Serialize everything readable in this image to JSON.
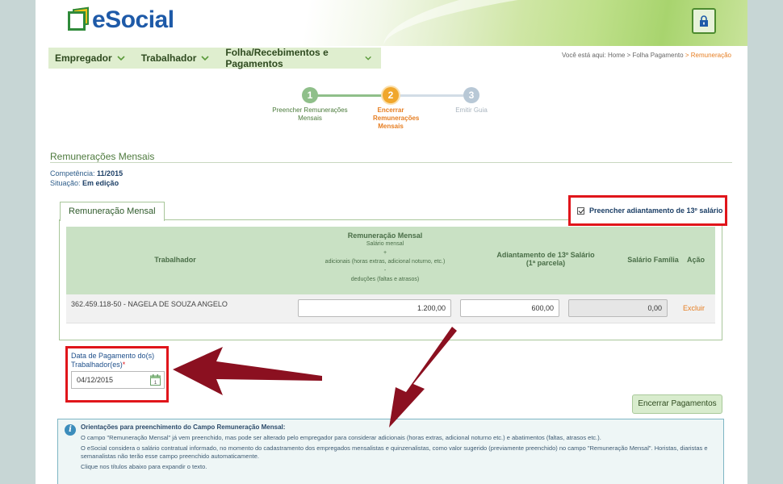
{
  "header": {
    "logo_text": "eSocial",
    "lock_icon": "padlock-icon"
  },
  "nav": {
    "items": [
      {
        "label": "Empregador"
      },
      {
        "label": "Trabalhador"
      },
      {
        "label": "Folha/Recebimentos e Pagamentos"
      }
    ]
  },
  "breadcrumb": {
    "prefix": "Você está aqui:",
    "home": "Home",
    "sep": ">",
    "folha": "Folha Pagamento",
    "current": "Remuneração"
  },
  "steps": [
    {
      "num": "1",
      "label": "Preencher Remunerações Mensais",
      "state": "done",
      "color": "#8fbf8a"
    },
    {
      "num": "2",
      "label": "Encerrar Remunerações Mensais",
      "state": "active",
      "color": "#f0a72c"
    },
    {
      "num": "3",
      "label": "Emitir Guia",
      "state": "pending",
      "color": "#b8c8d6"
    }
  ],
  "section": {
    "title": "Remunerações Mensais",
    "competencia_label": "Competência:",
    "competencia_value": "11/2015",
    "situacao_label": "Situação:",
    "situacao_value": "Em edição"
  },
  "tab": {
    "label": "Remuneração Mensal"
  },
  "checkbox": {
    "label": "Preencher adiantamento de 13º salário",
    "checked": true
  },
  "table": {
    "headers": {
      "trabalhador": "Trabalhador",
      "remuneracao": "Remuneração Mensal",
      "remuneracao_sub1": "Salário mensal",
      "remuneracao_sub2": "+",
      "remuneracao_sub3": "adicionais (horas extras, adicional noturno, etc.)",
      "remuneracao_sub4": "-",
      "remuneracao_sub5": "deduções (faltas e atrasos)",
      "adiantamento": "Adiantamento de 13º Salário",
      "adiantamento_sub": "(1ª parcela)",
      "salario_familia": "Salário Família",
      "acao": "Ação"
    },
    "rows": [
      {
        "trabalhador": "362.459.118-50 - NAGELA DE SOUZA ANGELO",
        "remuneracao": "1.200,00",
        "adiantamento": "600,00",
        "salario_familia": "0,00",
        "acao": "Excluir"
      }
    ]
  },
  "date_field": {
    "label_line1": "Data de Pagamento do(s)",
    "label_line2": "Trabalhador(es)",
    "required": "*",
    "value": "04/12/2015"
  },
  "button_encerrar": "Encerrar Pagamentos",
  "info": {
    "title": "Orientações para preenchimento do Campo Remuneração Mensal:",
    "p1": "O campo \"Remuneração Mensal\" já vem preenchido, mas pode ser alterado pelo empregador para considerar adicionais (horas extras, adicional noturno etc.) e abatimentos (faltas, atrasos etc.).",
    "p2": "O eSocial considera o salário contratual informado, no momento do cadastramento dos empregados mensalistas e quinzenalistas, como valor sugerido (previamente preenchido) no campo \"Remuneração Mensal\". Horistas, diaristas e semanalistas não terão esse campo preenchido automaticamente.",
    "p3": "Clique nos títulos abaixo para expandir o texto."
  },
  "colors": {
    "annotation_red": "#e0151b",
    "arrow_dark_red": "#8b1020",
    "accent_orange": "#e67e22"
  }
}
